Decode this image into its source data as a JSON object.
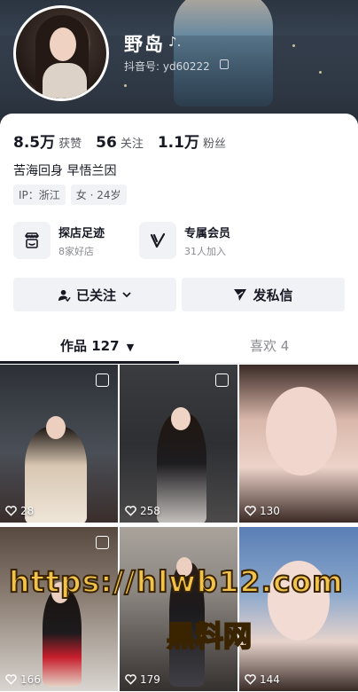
{
  "profile": {
    "nickname": "野岛",
    "nickname_mark": "♪.",
    "douyin_id": "抖音号: yd60222",
    "copy_icon": "copy-icon"
  },
  "stats": [
    {
      "value": "8.5万",
      "label": "获赞"
    },
    {
      "value": "56",
      "label": "关注"
    },
    {
      "value": "1.1万",
      "label": "粉丝"
    }
  ],
  "bio": "苦海回身  早悟兰因",
  "tags": [
    "IP：浙江",
    "女 · 24岁"
  ],
  "features": [
    {
      "title": "探店足迹",
      "subtitle": "8家好店",
      "icon": "shop-icon"
    },
    {
      "title": "专属会员",
      "subtitle": "31人加入",
      "icon": "vip-v-icon"
    }
  ],
  "actions": {
    "followed_label": "已关注",
    "message_label": "发私信"
  },
  "tabs": {
    "works_label": "作品 127",
    "likes_label": "喜欢 4"
  },
  "posts": [
    {
      "likes": "28",
      "pinned": true
    },
    {
      "likes": "258",
      "pinned": true
    },
    {
      "likes": "130",
      "pinned": false
    },
    {
      "likes": "166",
      "pinned": true
    },
    {
      "likes": "179",
      "pinned": false
    },
    {
      "likes": "144",
      "pinned": false
    }
  ],
  "watermark": {
    "url": "https://hlwb12.com",
    "text": "黑料网"
  },
  "colors": {
    "accent_text": "#161823",
    "button_bg": "#f1f2f5",
    "watermark": "#f2c34b"
  }
}
